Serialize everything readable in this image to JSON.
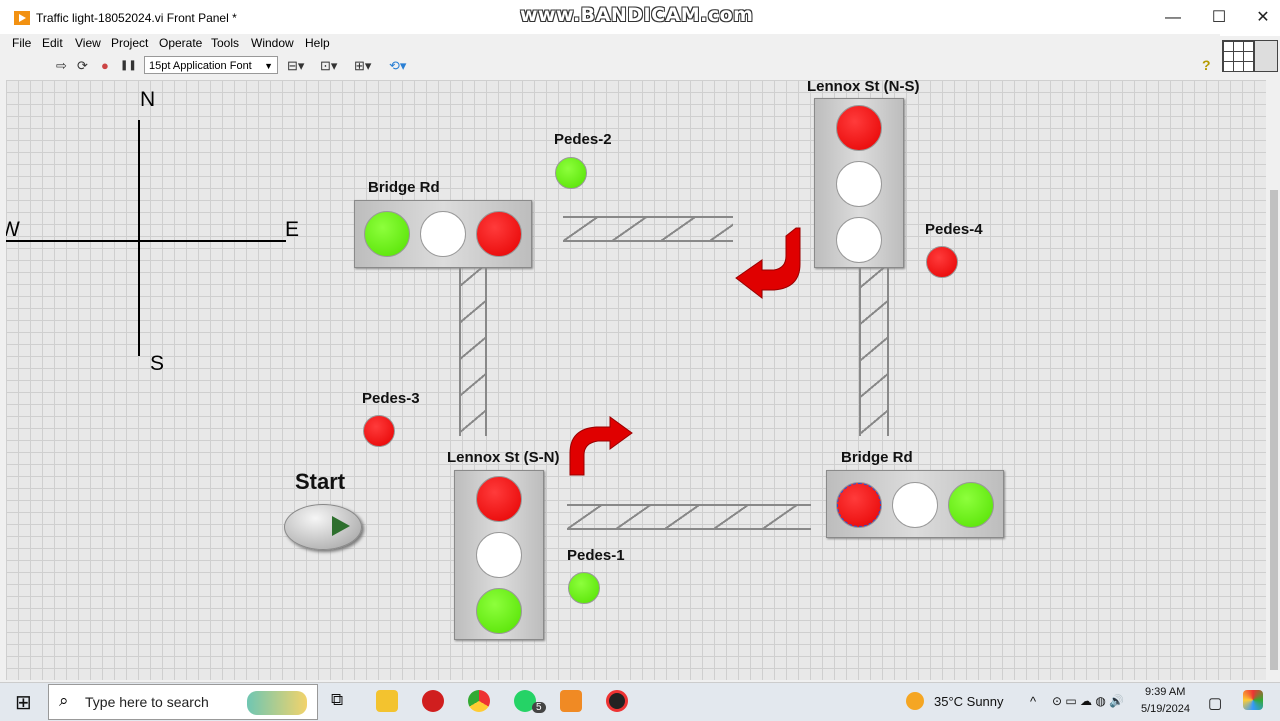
{
  "window": {
    "title": "Traffic light-18052024.vi Front Panel *",
    "watermark": "www.BANDICAM.com",
    "min_icon": "—",
    "max_icon": "☐",
    "close_icon": "✕"
  },
  "menu": [
    "File",
    "Edit",
    "View",
    "Project",
    "Operate",
    "Tools",
    "Window",
    "Help"
  ],
  "toolbar": {
    "font": "15pt Application Font",
    "run_icon": "⇨",
    "run_cont_icon": "⟳",
    "abort_icon": "●",
    "pause_icon": "❚❚",
    "align_icon": "⊟▾",
    "distribute_icon": "⊡▾",
    "resize_icon": "⊞▾",
    "reorder_icon": "⟲▾",
    "help_icon": "?"
  },
  "compass": {
    "n": "N",
    "s": "S",
    "e": "E",
    "w": "W"
  },
  "labels": {
    "bridge_rd_top": "Bridge Rd",
    "bridge_rd_bottom": "Bridge Rd",
    "lennox_ns": "Lennox St (N-S)",
    "lennox_sn": "Lennox St (S-N)",
    "pedes_1": "Pedes-1",
    "pedes_2": "Pedes-2",
    "pedes_3": "Pedes-3",
    "pedes_4": "Pedes-4",
    "start": "Start"
  },
  "lights": {
    "bridge_rd_top": [
      "green",
      "white",
      "red"
    ],
    "lennox_ns": [
      "red",
      "white",
      "white"
    ],
    "lennox_sn": [
      "red",
      "white",
      "green"
    ],
    "bridge_rd_bottom": [
      "red",
      "white",
      "green"
    ]
  },
  "pedestrian": {
    "pedes_1": "green",
    "pedes_2": "green",
    "pedes_3": "red",
    "pedes_4": "red"
  },
  "colors": {
    "red": "#e50000",
    "green": "#52e000",
    "white": "#ffffff",
    "arrow": "#e00000"
  },
  "taskbar": {
    "windows_icon": "⊞",
    "search_icon": "⌕",
    "search_placeholder": "Type here to search",
    "task_view_icon": "⧉",
    "whatsapp_badge": "5",
    "weather": "35°C  Sunny",
    "chevron_icon": "^",
    "time": "9:39 AM",
    "date": "5/19/2024",
    "notification_icon": "▢"
  }
}
